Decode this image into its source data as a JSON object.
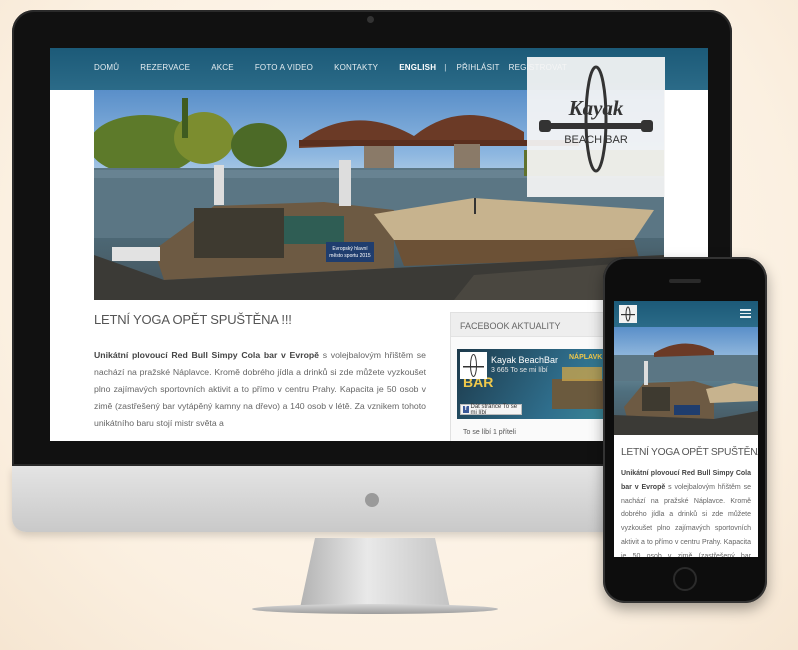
{
  "nav": {
    "items": [
      "DOMŮ",
      "REZERVACE",
      "AKCE",
      "FOTO A VIDEO",
      "KONTAKTY"
    ],
    "english": "ENGLISH",
    "separator": "|",
    "login": "PŘIHLÁSIT",
    "register": "REGISTROVAT"
  },
  "brand": {
    "logo_word": "Kayak",
    "logo_sub": "BEACH BAR"
  },
  "hero": {
    "banner_line1": "Evropský hlavní",
    "banner_line2": "město sportu 2015"
  },
  "article": {
    "title": "LETNÍ YOGA OPĚT SPUŠTĚNA !!!",
    "lead_bold": "Unikátní plovoucí Red Bull Simpy Cola bar v Evropě",
    "body": " s volejbalovým hřištěm se nachází na pražské Náplavce. Kromě dobrého jídla a drinků si zde můžete vyzkoušet plno zajímavých sportovních aktivit a to přímo v centru Prahy. Kapacita je 50 osob v zimě (zastřešený bar vytápěný kamny na dřevo) a 140 osob v létě. Za vznikem tohoto unikátního baru stojí mistr světa a"
  },
  "facebook": {
    "section_title": "FACEBOOK AKTUALITY",
    "page_name": "Kayak BeachBar",
    "likes": "3 665 To se mi líbí",
    "like_button": "Dát stránce To se mi líbí",
    "cover_word1": "NÁPLAVK",
    "cover_word2": "BAR",
    "friends": "To se líbí 1 příteli"
  },
  "phone": {
    "title": "LETNÍ YOGA OPĚT SPUŠTĚNA !!!",
    "lead_bold": "Unikátní plovoucí Red Bull Simpy Cola bar v Evropě",
    "body": " s volejbalovým hřištěm se nachází na pražské Náplavce. Kromě dobrého jídla a drinků si zde můžete vyzkoušet plno zajímavých sportovních aktivit a to přímo v centru Prahy. Kapacita je 50 osob v zimě (zastřešený bar vytápěný kamny na dřevo) a 140 osob v létě. Za vznikem tohoto"
  },
  "colors": {
    "nav": "#1f5e7c",
    "background": "#fbf0e1"
  }
}
